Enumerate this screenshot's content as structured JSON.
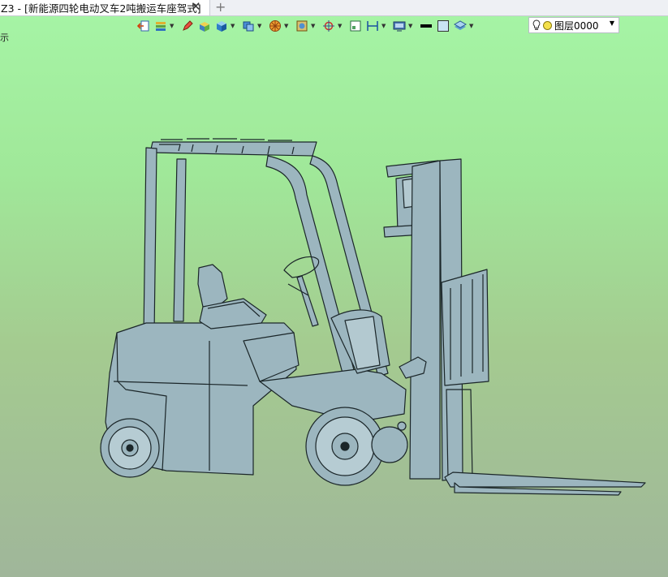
{
  "tab": {
    "title": "Z3 - [新能源四轮电动叉车2吨搬运车座驾式]",
    "close": "✕",
    "add": "+"
  },
  "layer": {
    "name": "图层0000"
  },
  "hint": {
    "text": "示"
  },
  "toolbar": {
    "icons": [
      "exit-icon",
      "layer-manager-icon",
      "pen-icon",
      "shaded-solid-icon",
      "box-shade-icon",
      "view-cube-icon",
      "wheel-icon",
      "render-icon",
      "target-icon",
      "frame-icon",
      "dimension-icon",
      "screen-icon",
      "line-color-swatch",
      "fill-color-swatch",
      "layer-stack-icon"
    ]
  },
  "colors": {
    "background_top": "#a6f5a6",
    "background_bottom": "#a0b69a",
    "model_fill": "#9cb6bf",
    "model_stroke": "#1b2629"
  }
}
